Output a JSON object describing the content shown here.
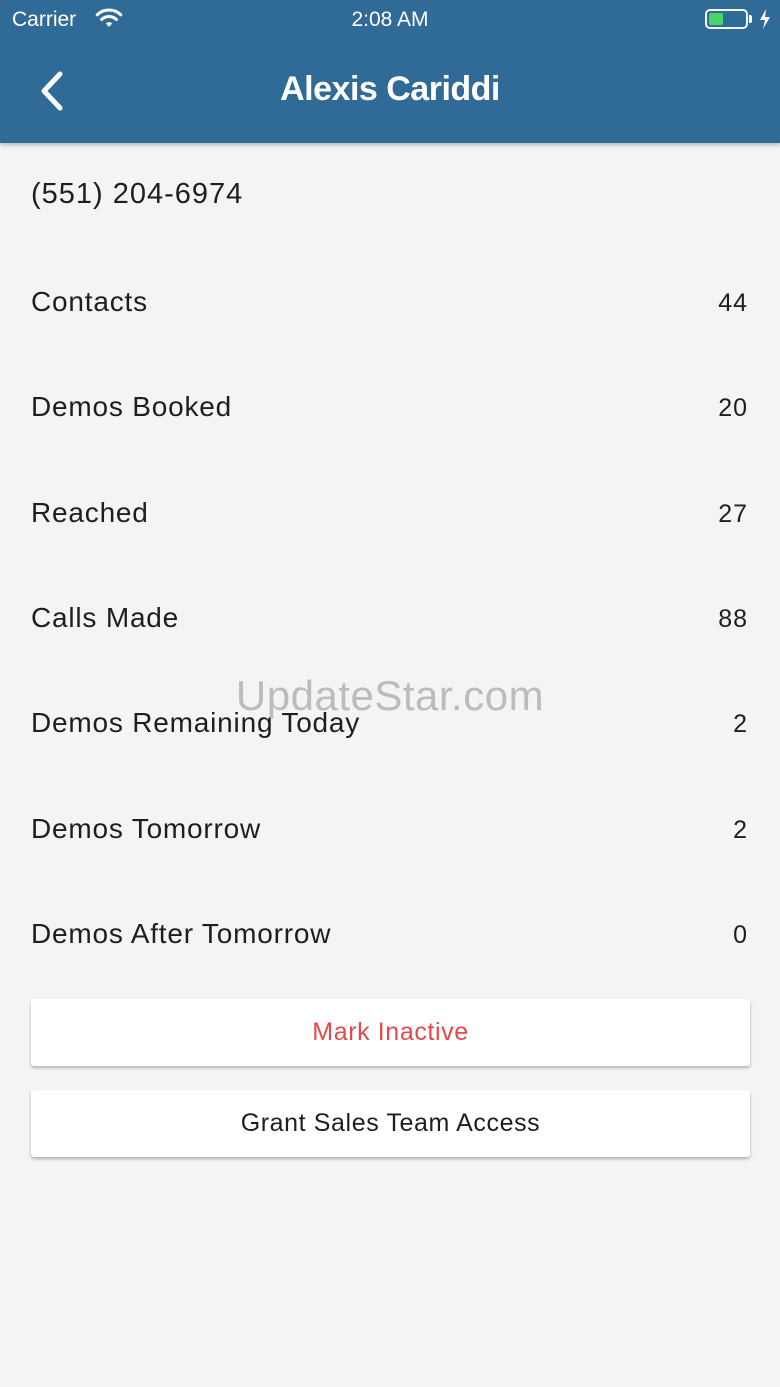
{
  "status_bar": {
    "carrier": "Carrier",
    "time": "2:08 AM",
    "battery_color": "#4cd964"
  },
  "header": {
    "title": "Alexis Cariddi",
    "background": "#306b98",
    "back_icon": "chevron-left-icon"
  },
  "contact": {
    "phone": "(551) 204-6974"
  },
  "stats": [
    {
      "label": "Contacts",
      "value": "44"
    },
    {
      "label": "Demos Booked",
      "value": "20"
    },
    {
      "label": "Reached",
      "value": "27"
    },
    {
      "label": "Calls Made",
      "value": "88"
    },
    {
      "label": "Demos Remaining Today",
      "value": "2"
    },
    {
      "label": "Demos Tomorrow",
      "value": "2"
    },
    {
      "label": "Demos After Tomorrow",
      "value": "0"
    }
  ],
  "actions": {
    "mark_inactive": "Mark Inactive",
    "mark_inactive_color": "#e5484b",
    "grant_access": "Grant Sales Team Access"
  },
  "watermark": "UpdateStar.com"
}
